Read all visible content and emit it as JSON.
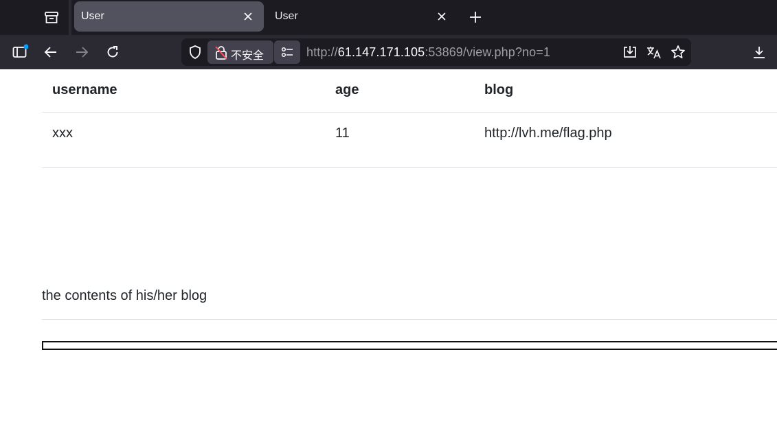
{
  "tabs": [
    {
      "label": "User",
      "active": true
    },
    {
      "label": "User",
      "active": false
    }
  ],
  "address_bar": {
    "security_label": "不安全",
    "url_prefix": "http://",
    "url_host": "61.147.171.105",
    "url_rest": ":53869/view.php?no=1"
  },
  "table": {
    "headers": [
      "username",
      "age",
      "blog"
    ],
    "rows": [
      [
        "xxx",
        "11",
        "http://lvh.me/flag.php"
      ]
    ]
  },
  "blog_caption": "the contents of his/her blog",
  "colors": {
    "tab_strip": "#1c1b22",
    "toolbar": "#2b2a33",
    "active_tab": "#52525e",
    "sidebar_dot": "#00a2ff"
  }
}
